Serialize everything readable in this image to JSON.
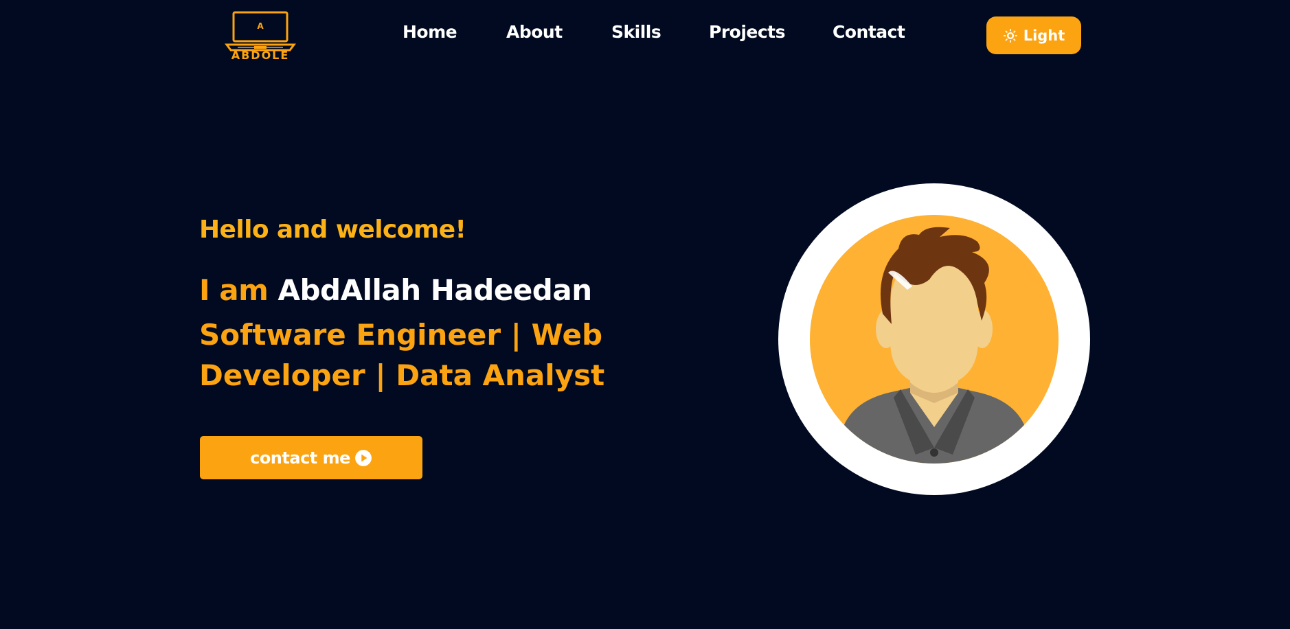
{
  "header": {
    "logo_letter": "A",
    "logo_name": "ABDOLE",
    "nav": [
      {
        "label": "Home"
      },
      {
        "label": "About"
      },
      {
        "label": "Skills"
      },
      {
        "label": "Projects"
      },
      {
        "label": "Contact"
      }
    ],
    "theme_button": {
      "label": "Light",
      "icon": "sun-icon"
    }
  },
  "hero": {
    "greeting": "Hello and welcome!",
    "intro_prefix": "I am",
    "name": "AbdAllah Hadeedan",
    "role": "Software Engineer | Web Developer | Data Analyst",
    "contact_button": {
      "label": "contact me",
      "icon": "play-circle-icon"
    },
    "avatar_icon": "user-avatar-icon"
  },
  "colors": {
    "background": "#010a21",
    "accent": "#fca311",
    "avatar_bg": "#feb132",
    "text": "#ffffff"
  }
}
